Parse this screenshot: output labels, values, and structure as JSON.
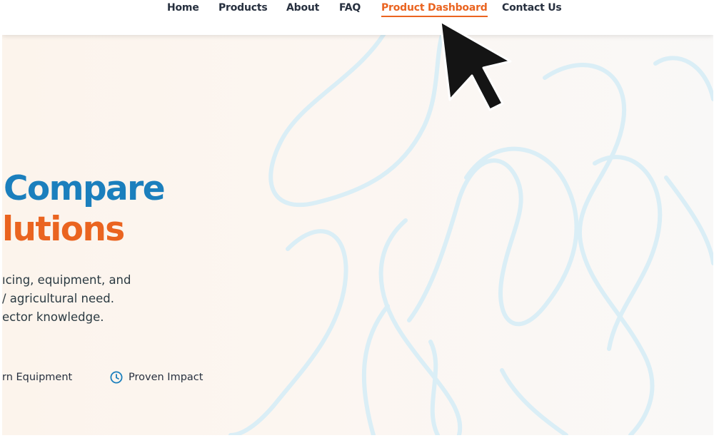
{
  "nav": {
    "items": [
      {
        "label": "Home",
        "active": false
      },
      {
        "label": "Products",
        "active": false
      },
      {
        "label": "About",
        "active": false
      },
      {
        "label": "FAQ",
        "active": false
      },
      {
        "label": "Product Dashboard",
        "active": true
      },
      {
        "label": "Contact Us",
        "active": false
      }
    ]
  },
  "hero": {
    "headline_line1": "Compare",
    "headline_line2": "lutions",
    "description": [
      "ıcing, equipment, and",
      "/ agricultural need.",
      "ector knowledge."
    ],
    "features": [
      {
        "label": "rn Equipment",
        "icon": "equipment-icon"
      },
      {
        "label": "Proven Impact",
        "icon": "clock-icon"
      }
    ]
  },
  "colors": {
    "accent_orange": "#ea6420",
    "accent_blue": "#1b7fbd",
    "text_dark": "#27303f",
    "hero_background": "#fcf6f0",
    "pattern_stroke": "#daeef6"
  },
  "cursor": {
    "icon": "mouse-pointer-icon"
  }
}
